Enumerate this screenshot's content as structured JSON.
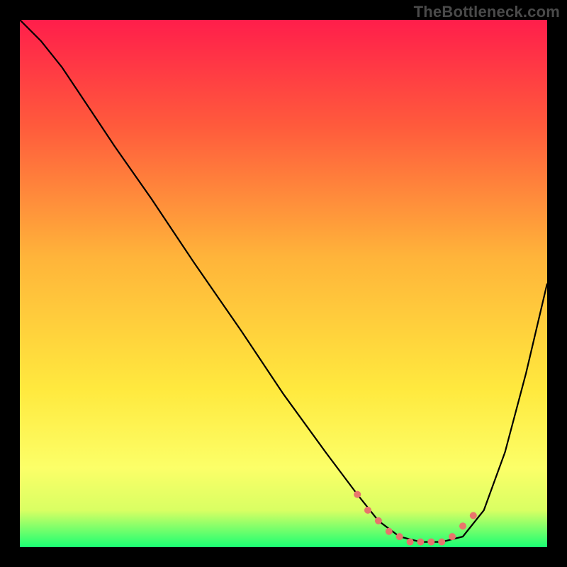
{
  "watermark": "TheBottleneck.com",
  "chart_data": {
    "type": "line",
    "title": "",
    "xlabel": "",
    "ylabel": "",
    "xlim": [
      0,
      100
    ],
    "ylim": [
      0,
      100
    ],
    "annotations": [],
    "gradient_stops": [
      {
        "offset": 0,
        "color": "#ff1e4b"
      },
      {
        "offset": 20,
        "color": "#ff5a3c"
      },
      {
        "offset": 45,
        "color": "#ffb43a"
      },
      {
        "offset": 70,
        "color": "#ffe93e"
      },
      {
        "offset": 85,
        "color": "#fcff68"
      },
      {
        "offset": 93,
        "color": "#d9ff63"
      },
      {
        "offset": 100,
        "color": "#1aff73"
      }
    ],
    "series": [
      {
        "name": "bottleneck-curve",
        "color": "#000000",
        "x": [
          0,
          4,
          8,
          12,
          18,
          25,
          33,
          42,
          50,
          58,
          64,
          68,
          72,
          76,
          80,
          84,
          88,
          92,
          96,
          100
        ],
        "y": [
          100,
          96,
          91,
          85,
          76,
          66,
          54,
          41,
          29,
          18,
          10,
          5,
          2,
          1,
          1,
          2,
          7,
          18,
          33,
          50
        ]
      }
    ],
    "scatter": {
      "name": "highlight-dots",
      "color": "#e8746c",
      "x": [
        64,
        66,
        68,
        70,
        72,
        74,
        76,
        78,
        80,
        82,
        84,
        86
      ],
      "y": [
        10,
        7,
        5,
        3,
        2,
        1,
        1,
        1,
        1,
        2,
        4,
        6
      ]
    }
  }
}
